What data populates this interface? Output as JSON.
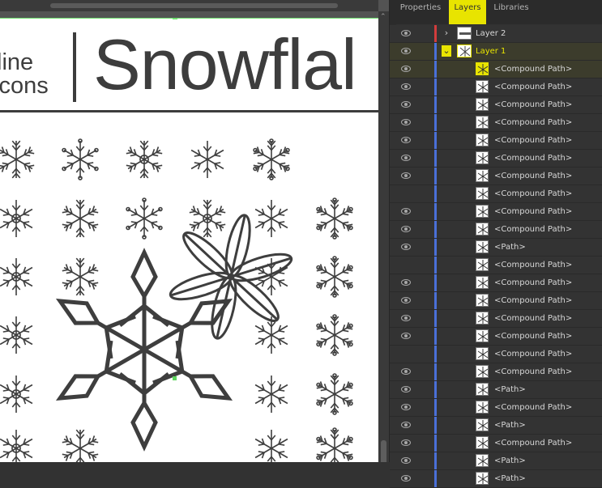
{
  "canvas": {
    "header_line1": "line",
    "header_line2": "icons",
    "header_title": "Snowflal"
  },
  "panel": {
    "tabs": [
      {
        "label": "Properties",
        "active": false
      },
      {
        "label": "Layers",
        "active": true
      },
      {
        "label": "Libraries",
        "active": false
      }
    ],
    "layers": [
      {
        "name": "Layer 2",
        "visible": true,
        "color": "#d23c3c",
        "twirl": "›"
      },
      {
        "name": "Layer 1",
        "visible": true,
        "color": "#4a70d8",
        "twirl": "⌄",
        "highlight": true
      }
    ],
    "items": [
      {
        "name": "<Compound Path>",
        "visible": true
      },
      {
        "name": "<Compound Path>",
        "visible": true
      },
      {
        "name": "<Compound Path>",
        "visible": true
      },
      {
        "name": "<Compound Path>",
        "visible": true
      },
      {
        "name": "<Compound Path>",
        "visible": true
      },
      {
        "name": "<Compound Path>",
        "visible": true
      },
      {
        "name": "<Compound Path>",
        "visible": true
      },
      {
        "name": "<Compound Path>",
        "visible": false
      },
      {
        "name": "<Compound Path>",
        "visible": true
      },
      {
        "name": "<Compound Path>",
        "visible": true
      },
      {
        "name": "<Path>",
        "visible": true
      },
      {
        "name": "<Compound Path>",
        "visible": false
      },
      {
        "name": "<Compound Path>",
        "visible": true
      },
      {
        "name": "<Compound Path>",
        "visible": true
      },
      {
        "name": "<Compound Path>",
        "visible": true
      },
      {
        "name": "<Compound Path>",
        "visible": true
      },
      {
        "name": "<Compound Path>",
        "visible": false
      },
      {
        "name": "<Compound Path>",
        "visible": true
      },
      {
        "name": "<Path>",
        "visible": true
      },
      {
        "name": "<Compound Path>",
        "visible": true
      },
      {
        "name": "<Path>",
        "visible": true
      },
      {
        "name": "<Compound Path>",
        "visible": true
      },
      {
        "name": "<Path>",
        "visible": true
      },
      {
        "name": "<Path>",
        "visible": true
      }
    ],
    "highlight_color": "#e8e400"
  }
}
